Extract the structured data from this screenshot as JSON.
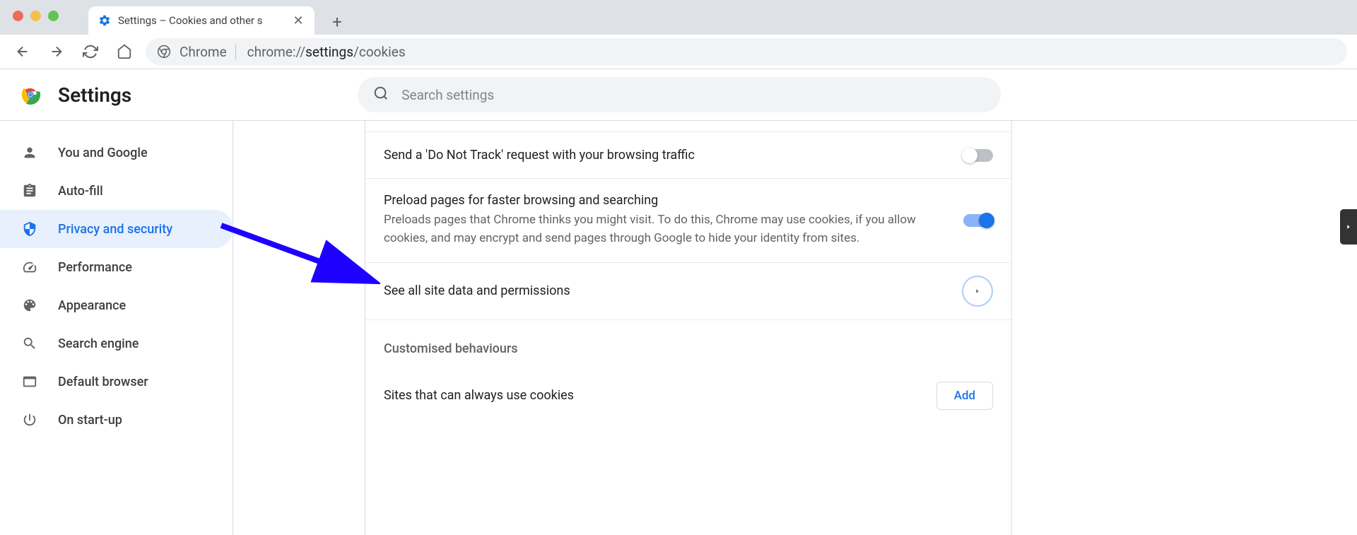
{
  "tab": {
    "title": "Settings – Cookies and other s"
  },
  "omnibox": {
    "prefix": "Chrome",
    "url_pre": "chrome://",
    "url_bold": "settings",
    "url_post": "/cookies"
  },
  "header": {
    "title": "Settings",
    "search_placeholder": "Search settings"
  },
  "sidebar": {
    "items": [
      {
        "label": "You and Google"
      },
      {
        "label": "Auto-fill"
      },
      {
        "label": "Privacy and security"
      },
      {
        "label": "Performance"
      },
      {
        "label": "Appearance"
      },
      {
        "label": "Search engine"
      },
      {
        "label": "Default browser"
      },
      {
        "label": "On start-up"
      }
    ]
  },
  "content": {
    "dnt": {
      "title": "Send a 'Do Not Track' request with your browsing traffic"
    },
    "preload": {
      "title": "Preload pages for faster browsing and searching",
      "desc": "Preloads pages that Chrome thinks you might visit. To do this, Chrome may use cookies, if you allow cookies, and may encrypt and send pages through Google to hide your identity from sites."
    },
    "see_all": {
      "title": "See all site data and permissions"
    },
    "custom_header": "Customised behaviours",
    "always_cookies": {
      "title": "Sites that can always use cookies"
    },
    "add_label": "Add"
  }
}
